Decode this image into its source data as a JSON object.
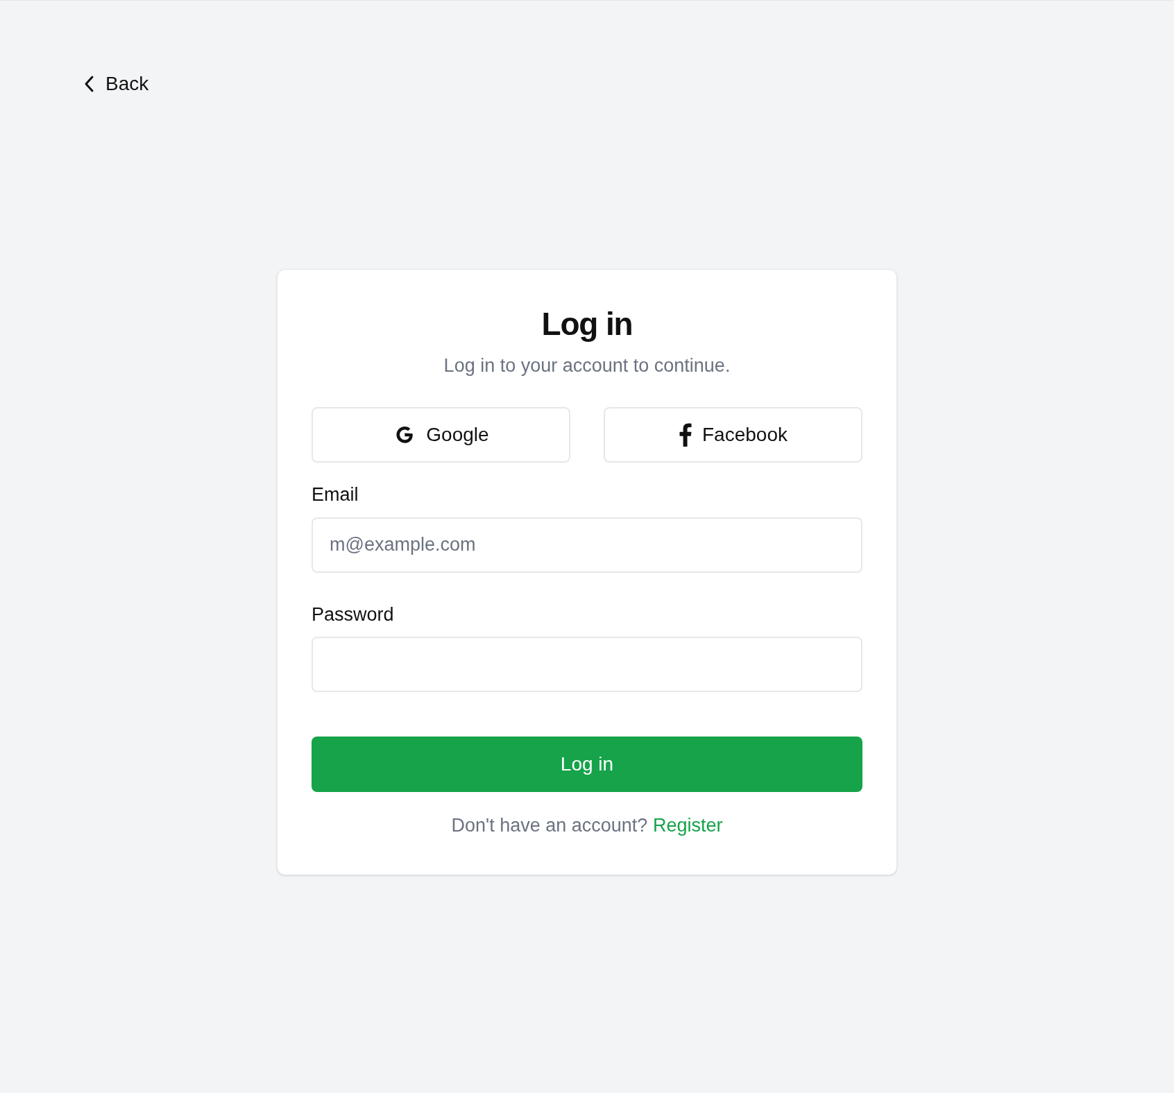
{
  "back": {
    "label": "Back"
  },
  "card": {
    "title": "Log in",
    "subtitle": "Log in to your account to continue.",
    "social_buttons": [
      {
        "kind": "google",
        "label": "Google"
      },
      {
        "kind": "facebook",
        "label": "Facebook"
      }
    ],
    "fields": [
      {
        "label": "Email",
        "placeholder": "m@example.com"
      },
      {
        "label": "Password"
      }
    ],
    "submit": "Log in",
    "footer": {
      "text": "Don't have an account?",
      "link": "Register"
    }
  }
}
